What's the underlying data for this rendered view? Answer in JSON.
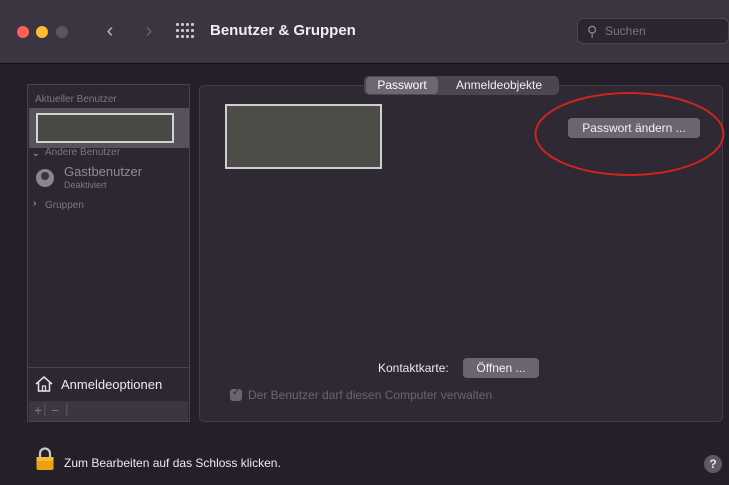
{
  "window": {
    "title": "Benutzer & Gruppen",
    "search_placeholder": "Suchen"
  },
  "sidebar": {
    "current_user_header": "Aktueller Benutzer",
    "other_users_header": "Andere Benutzer",
    "guest": {
      "name": "Gastbenutzer",
      "status": "Deaktiviert"
    },
    "groups_header": "Gruppen",
    "login_options": "Anmeldeoptionen",
    "add": "+",
    "remove": "−"
  },
  "tabs": [
    {
      "label": "Passwort",
      "active": true
    },
    {
      "label": "Anmeldeobjekte",
      "active": false
    }
  ],
  "main": {
    "change_password_button": "Passwort ändern ...",
    "contact_card_label": "Kontaktkarte:",
    "contact_card_button": "Öffnen ...",
    "admin_checkbox_label": "Der Benutzer darf diesen Computer verwalten",
    "admin_checked": true
  },
  "footer": {
    "lock_text": "Zum Bearbeiten auf das Schloss klicken.",
    "help": "?"
  },
  "colors": {
    "annotation": "#d0241c",
    "window_bg": "#241f29",
    "panel_bg": "#2e2933"
  }
}
